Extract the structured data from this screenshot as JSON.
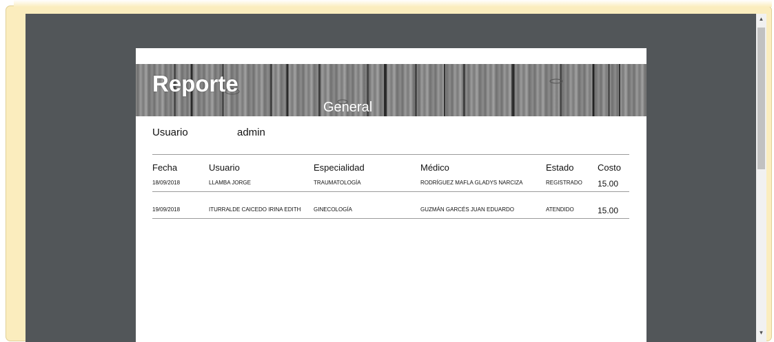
{
  "report": {
    "title": "Reporte",
    "subtitle": "General",
    "user_label": "Usuario",
    "user_value": "admin",
    "columns": [
      "Fecha",
      "Usuario",
      "Especialidad",
      "Médico",
      "Estado",
      "Costo"
    ],
    "rows": [
      {
        "fecha": "18/09/2018",
        "usuario": "LLAMBA JORGE",
        "especialidad": "TRAUMATOLOGÍA",
        "medico": "RODRÍGUEZ MAFLA GLADYS NARCIZA",
        "estado": "REGISTRADO",
        "costo": "15.00"
      },
      {
        "fecha": "19/09/2018",
        "usuario": "ITURRALDE CAICEDO IRINA EDITH",
        "especialidad": "GINECOLOGÍA",
        "medico": "GUZMÁN GARCÉS JUAN EDUARDO",
        "estado": "ATENDIDO",
        "costo": "15.00"
      }
    ]
  },
  "scrollbar": {
    "up_icon": "triangle-up-icon",
    "down_icon": "triangle-down-icon"
  },
  "colors": {
    "frame": "#fbedbe",
    "viewer_background": "#525659",
    "page": "#ffffff"
  }
}
